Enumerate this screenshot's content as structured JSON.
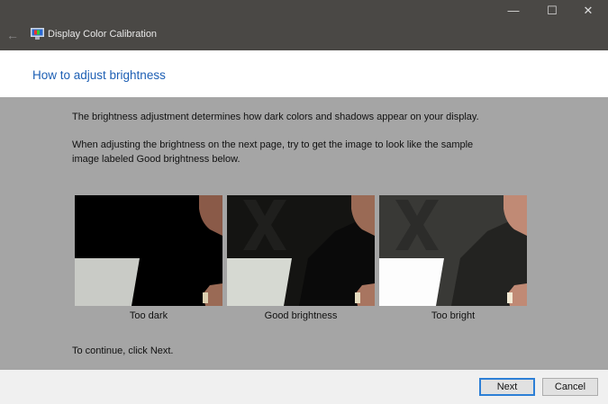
{
  "window": {
    "title": "Display Color Calibration",
    "minimize": "—",
    "maximize": "☐",
    "close": "✕",
    "back": "←"
  },
  "header": {
    "title": "How to adjust brightness"
  },
  "content": {
    "para1": "The brightness adjustment determines how dark colors and shadows appear on your display.",
    "para2a": "When adjusting the brightness on the next page, try to get the image to look like the sample",
    "para2b": "image labeled Good brightness below.",
    "samples": [
      {
        "label": "Too dark"
      },
      {
        "label": "Good brightness"
      },
      {
        "label": "Too bright"
      }
    ],
    "continue": "To continue, click Next."
  },
  "footer": {
    "next": "Next",
    "cancel": "Cancel"
  }
}
